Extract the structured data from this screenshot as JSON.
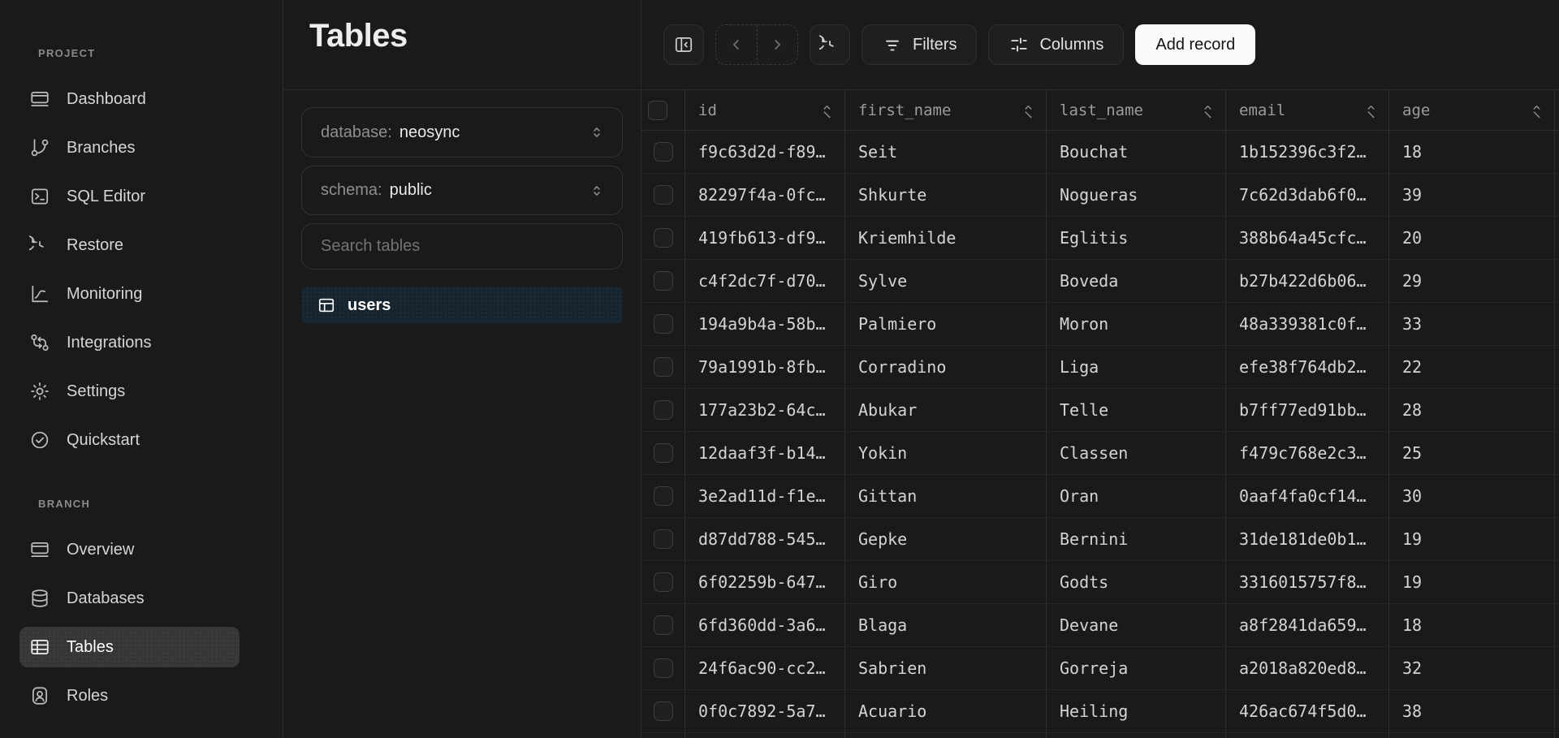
{
  "colors": {
    "active_nav_bg": "#363636",
    "active_table_bg": "#162430",
    "add_record_bg": "#fafafa",
    "add_record_text": "#141414"
  },
  "sidebar": {
    "sections": [
      {
        "label": "PROJECT",
        "items": [
          {
            "label": "Dashboard",
            "icon": "dashboard-icon"
          },
          {
            "label": "Branches",
            "icon": "branches-icon"
          },
          {
            "label": "SQL Editor",
            "icon": "sql-editor-icon"
          },
          {
            "label": "Restore",
            "icon": "restore-icon"
          },
          {
            "label": "Monitoring",
            "icon": "monitoring-icon"
          },
          {
            "label": "Integrations",
            "icon": "integrations-icon"
          },
          {
            "label": "Settings",
            "icon": "settings-icon"
          },
          {
            "label": "Quickstart",
            "icon": "quickstart-icon"
          }
        ]
      },
      {
        "label": "BRANCH",
        "items": [
          {
            "label": "Overview",
            "icon": "overview-icon"
          },
          {
            "label": "Databases",
            "icon": "databases-icon"
          },
          {
            "label": "Tables",
            "icon": "tables-icon",
            "active": true
          },
          {
            "label": "Roles",
            "icon": "roles-icon"
          }
        ]
      }
    ]
  },
  "panel": {
    "title": "Tables",
    "database_label": "database:",
    "database_value": "neosync",
    "schema_label": "schema:",
    "schema_value": "public",
    "search_placeholder": "Search tables",
    "tables": [
      {
        "name": "users",
        "active": true
      }
    ]
  },
  "toolbar": {
    "filters_label": "Filters",
    "columns_label": "Columns",
    "add_record_label": "Add record"
  },
  "table": {
    "columns": [
      "id",
      "first_name",
      "last_name",
      "email",
      "age"
    ],
    "rows": [
      [
        "f9c63d2d-f89…",
        "Seit",
        "Bouchat",
        "1b152396c3f2…",
        "18"
      ],
      [
        "82297f4a-0fc…",
        "Shkurte",
        "Nogueras",
        "7c62d3dab6f0…",
        "39"
      ],
      [
        "419fb613-df9…",
        "Kriemhilde",
        "Eglitis",
        "388b64a45cfc…",
        "20"
      ],
      [
        "c4f2dc7f-d70…",
        "Sylve",
        "Boveda",
        "b27b422d6b06…",
        "29"
      ],
      [
        "194a9b4a-58b…",
        "Palmiero",
        "Moron",
        "48a339381c0f…",
        "33"
      ],
      [
        "79a1991b-8fb…",
        "Corradino",
        "Liga",
        "efe38f764db2…",
        "22"
      ],
      [
        "177a23b2-64c…",
        "Abukar",
        "Telle",
        "b7ff77ed91bb…",
        "28"
      ],
      [
        "12daaf3f-b14…",
        "Yokin",
        "Classen",
        "f479c768e2c3…",
        "25"
      ],
      [
        "3e2ad11d-f1e…",
        "Gittan",
        "Oran",
        "0aaf4fa0cf14…",
        "30"
      ],
      [
        "d87dd788-545…",
        "Gepke",
        "Bernini",
        "31de181de0b1…",
        "19"
      ],
      [
        "6f02259b-647…",
        "Giro",
        "Godts",
        "3316015757f8…",
        "19"
      ],
      [
        "6fd360dd-3a6…",
        "Blaga",
        "Devane",
        "a8f2841da659…",
        "18"
      ],
      [
        "24f6ac90-cc2…",
        "Sabrien",
        "Gorreja",
        "a2018a820ed8…",
        "32"
      ],
      [
        "0f0c7892-5a7…",
        "Acuario",
        "Heiling",
        "426ac674f5d0…",
        "38"
      ]
    ]
  }
}
